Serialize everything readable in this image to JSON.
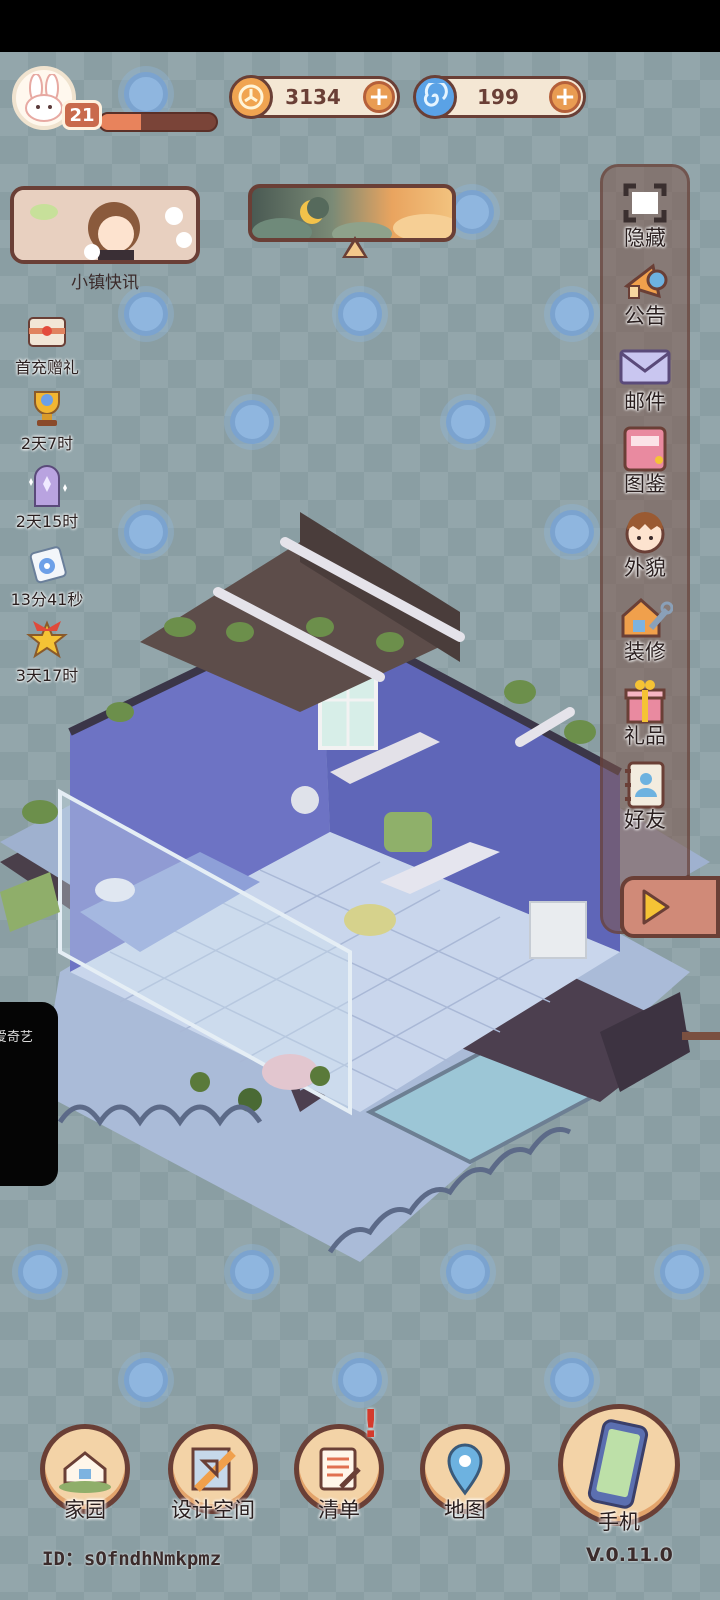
{
  "player": {
    "level": "21",
    "xp_fraction": 0.35,
    "avatar_icon": "bunny-icon"
  },
  "currencies": {
    "coins": {
      "value": "3134",
      "icon": "coin-icon",
      "color": "#f0a451"
    },
    "gems": {
      "value": "199",
      "icon": "swirl-icon",
      "color": "#5aa2e6"
    }
  },
  "news": {
    "label": "小镇快讯",
    "icon": "news-banner-icon"
  },
  "daynight": {
    "icon": "moon-icon"
  },
  "left_events": [
    {
      "label": "首充赠礼",
      "icon": "gift-letter-icon"
    },
    {
      "label": "2天7时",
      "icon": "trophy-icon"
    },
    {
      "label": "2天15时",
      "icon": "crystal-tombstone-icon"
    },
    {
      "label": "13分41秒",
      "icon": "ticket-icon"
    },
    {
      "label": "3天17时",
      "icon": "star-bow-icon"
    }
  ],
  "right_menu": [
    {
      "label": "隐藏",
      "icon": "hide-frame-icon"
    },
    {
      "label": "公告",
      "icon": "megaphone-icon"
    },
    {
      "label": "邮件",
      "icon": "mail-icon"
    },
    {
      "label": "图鉴",
      "icon": "album-icon"
    },
    {
      "label": "外貌",
      "icon": "character-face-icon"
    },
    {
      "label": "装修",
      "icon": "house-wrench-icon"
    },
    {
      "label": "礼品",
      "icon": "gift-icon"
    },
    {
      "label": "好友",
      "icon": "friend-book-icon"
    }
  ],
  "video_overlay": {
    "text": "爱奇艺"
  },
  "bottom_nav": [
    {
      "label": "家园",
      "icon": "home-icon"
    },
    {
      "label": "设计空间",
      "icon": "design-ruler-icon"
    },
    {
      "label": "清单",
      "icon": "checklist-icon"
    },
    {
      "label": "地图",
      "icon": "map-pin-icon"
    },
    {
      "label": "手机",
      "icon": "phone-icon"
    }
  ],
  "footer": {
    "id_text": "ID：sOfndhNmkpmz",
    "version": "V.0.11.0"
  }
}
